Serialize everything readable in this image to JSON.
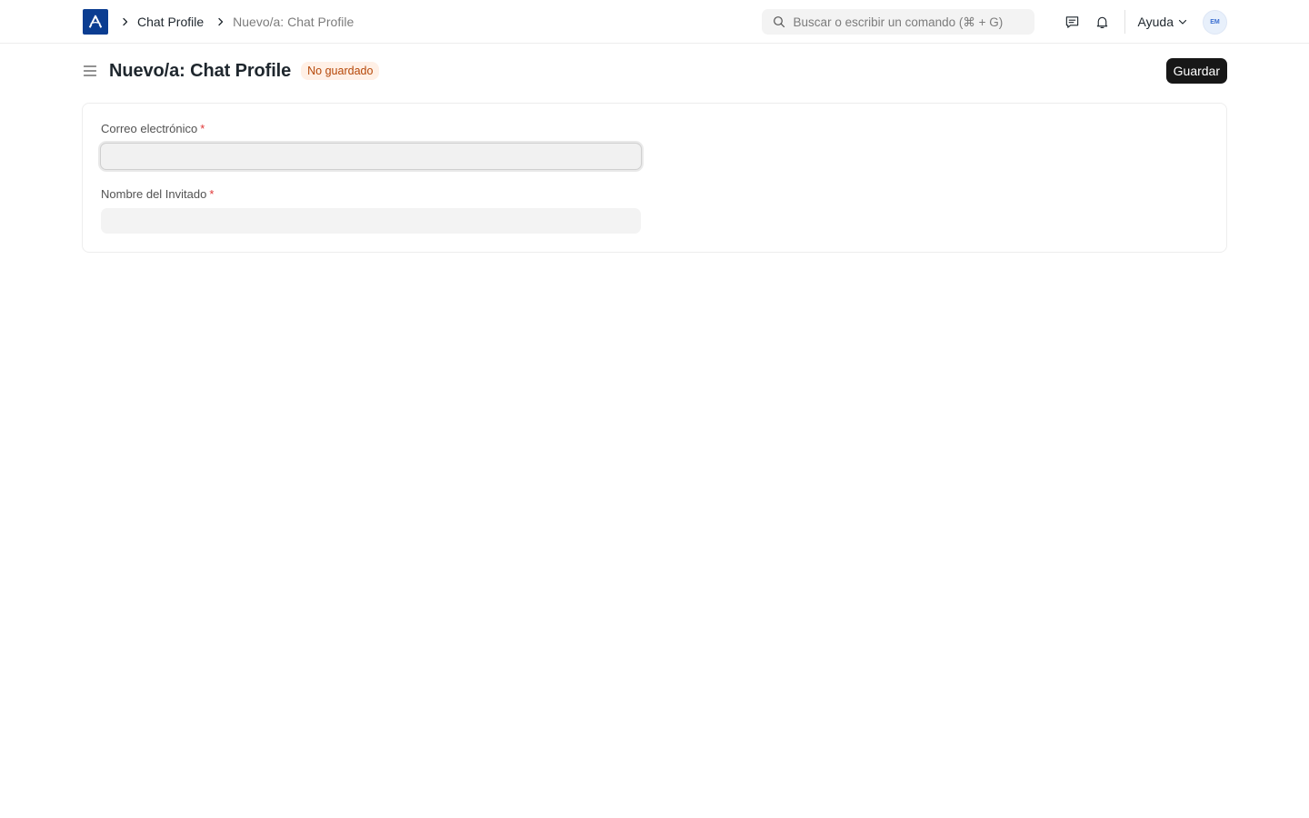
{
  "navbar": {
    "breadcrumbs": [
      {
        "label": "Chat Profile"
      },
      {
        "label": "Nuevo/a: Chat Profile"
      }
    ],
    "search_placeholder": "Buscar o escribir un comando (⌘ + G)",
    "help_label": "Ayuda",
    "avatar_initials": "EM"
  },
  "page": {
    "title": "Nuevo/a: Chat Profile",
    "status_badge": "No guardado",
    "save_label": "Guardar"
  },
  "form": {
    "fields": [
      {
        "label": "Correo electrónico",
        "required_mark": "*",
        "value": ""
      },
      {
        "label": "Nombre del Invitado",
        "required_mark": "*",
        "value": ""
      }
    ]
  },
  "colors": {
    "brand": "#0b3d91",
    "primary_button": "#171717",
    "badge_bg": "#fff0e6",
    "badge_text": "#b54708",
    "required": "#e03636"
  }
}
